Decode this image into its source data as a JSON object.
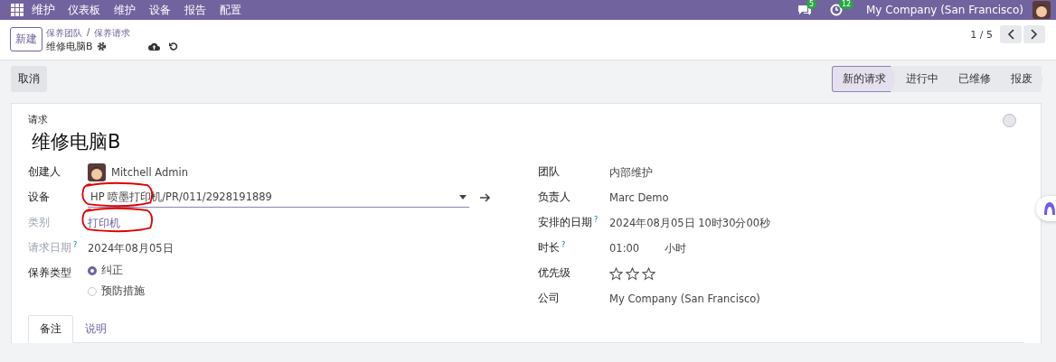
{
  "navbar": {
    "app": "维护",
    "menu": [
      "仪表板",
      "维护",
      "设备",
      "报告",
      "配置"
    ],
    "messages_count": "5",
    "activities_count": "12",
    "company": "My Company (San Francisco)"
  },
  "control_panel": {
    "new_button": "新建",
    "breadcrumbs": [
      "保养团队",
      "保养请求"
    ],
    "breadcrumb_separator": "/",
    "record": "维修电脑B",
    "pager": "1 / 5"
  },
  "status_bar": {
    "cancel_button": "取消",
    "stages": [
      {
        "label": "新的请求",
        "selected": true
      },
      {
        "label": "进行中",
        "selected": false
      },
      {
        "label": "已维修",
        "selected": false
      },
      {
        "label": "报废",
        "selected": false
      }
    ]
  },
  "form": {
    "title_label": "请求",
    "title": "维修电脑B",
    "left_fields": [
      {
        "kind": "user",
        "label": "创建人",
        "value": "Mitchell Admin",
        "muted": false,
        "circled": false
      },
      {
        "kind": "many2one",
        "label": "设备",
        "value": "HP 喷墨打印机/PR/011/2928191889",
        "muted": false,
        "circled": true
      },
      {
        "kind": "link",
        "label": "类别",
        "value": "打印机",
        "muted": true,
        "circled": true
      },
      {
        "kind": "text",
        "label": "请求日期",
        "value": "2024年08月05日",
        "muted": true,
        "help_mark": "?",
        "circled": false
      },
      {
        "kind": "radio",
        "label": "保养类型",
        "options": [
          {
            "label": "纠正",
            "selected": true
          },
          {
            "label": "预防措施",
            "selected": false
          }
        ],
        "muted": false,
        "circled": false
      }
    ],
    "right_fields": [
      {
        "kind": "text",
        "label": "团队",
        "value": "内部维护"
      },
      {
        "kind": "text",
        "label": "负责人",
        "value": "Marc Demo"
      },
      {
        "kind": "text",
        "label": "安排的日期",
        "value": "2024年08月05日 10时30分00秒",
        "help_mark": "?"
      },
      {
        "kind": "duration",
        "label": "时长",
        "value": "01:00",
        "unit": "小时",
        "help_mark": "?"
      },
      {
        "kind": "priority",
        "label": "优先级",
        "stars": 0
      },
      {
        "kind": "text",
        "label": "公司",
        "value": "My Company (San Francisco)"
      }
    ],
    "tabs": [
      {
        "label": "备注",
        "selected": true
      },
      {
        "label": "说明",
        "selected": false
      }
    ]
  }
}
